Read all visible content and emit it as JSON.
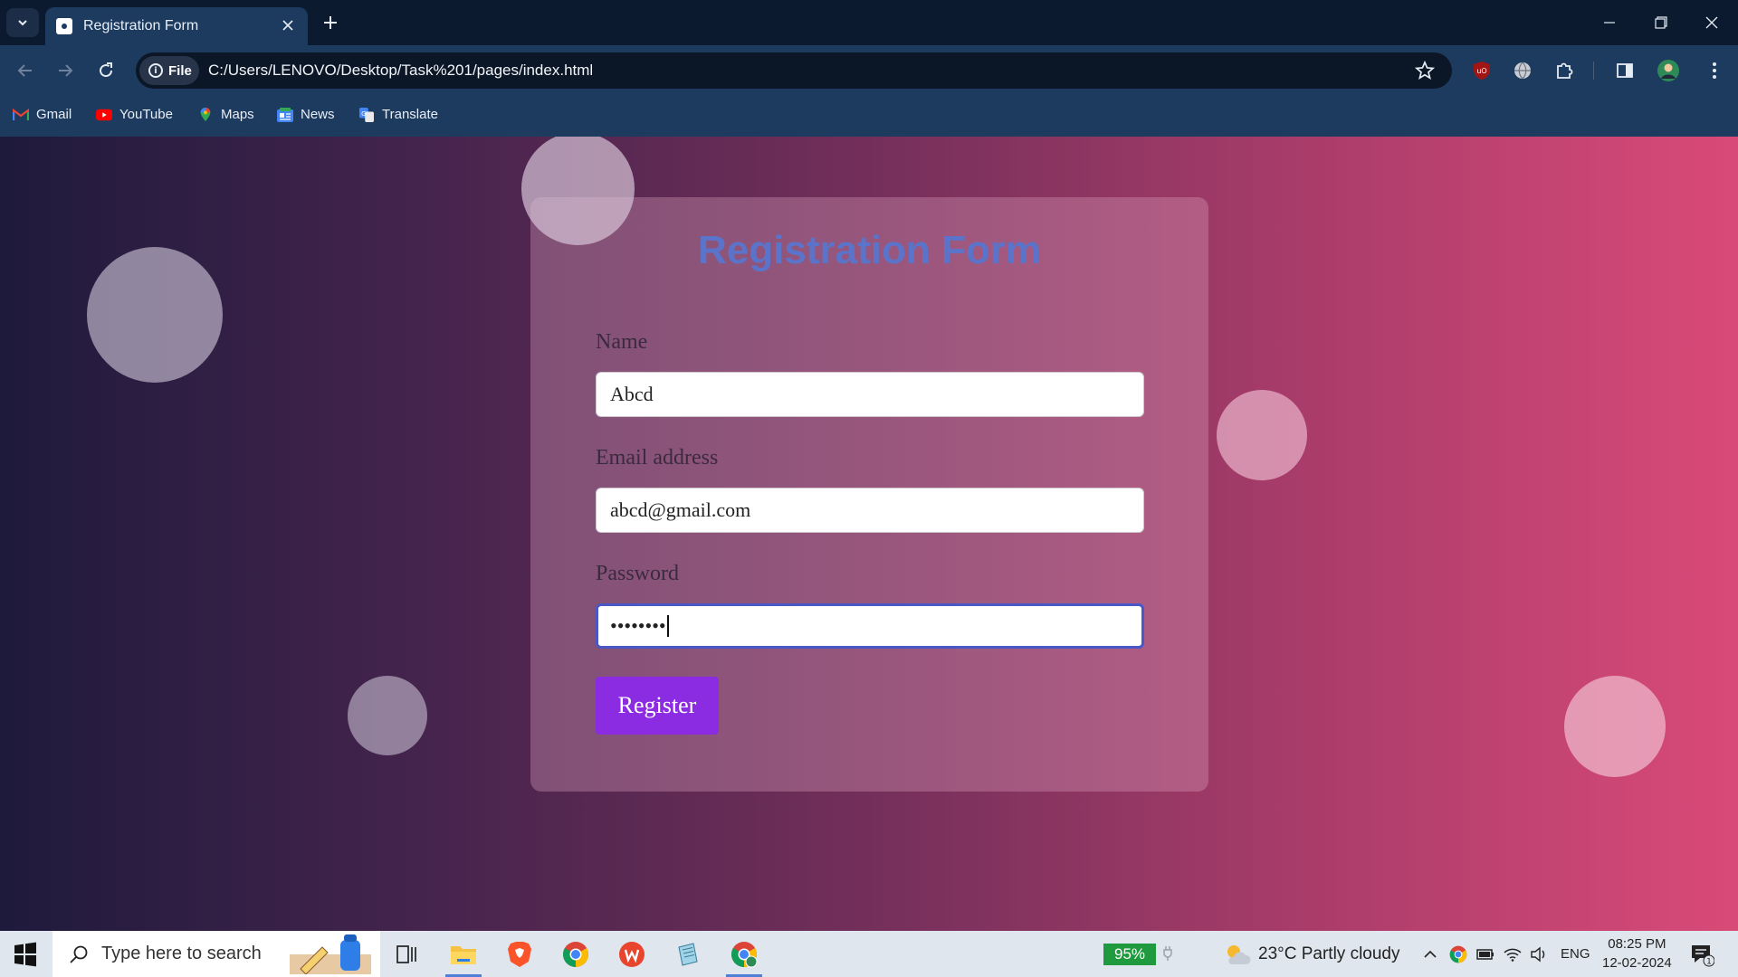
{
  "browser": {
    "tab_title": "Registration Form",
    "site_chip": "File",
    "url": "C:/Users/LENOVO/Desktop/Task%201/pages/index.html",
    "bookmarks": [
      {
        "label": "Gmail",
        "icon": "gmail-icon"
      },
      {
        "label": "YouTube",
        "icon": "youtube-icon"
      },
      {
        "label": "Maps",
        "icon": "maps-icon"
      },
      {
        "label": "News",
        "icon": "news-icon"
      },
      {
        "label": "Translate",
        "icon": "translate-icon"
      }
    ]
  },
  "form": {
    "title": "Registration Form",
    "name_label": "Name",
    "name_value": "Abcd",
    "email_label": "Email address",
    "email_value": "abcd@gmail.com",
    "password_label": "Password",
    "password_value": "••••••••",
    "submit_label": "Register"
  },
  "taskbar": {
    "search_placeholder": "Type here to search",
    "battery": "95%",
    "weather": "23°C  Partly cloudy",
    "language": "ENG",
    "time": "08:25 PM",
    "date": "12-02-2024",
    "notification_count": "1"
  },
  "colors": {
    "gradient_start": "#1e1a3c",
    "gradient_end": "#d94a78",
    "title": "#5b74c9",
    "button": "#8b2be2"
  }
}
